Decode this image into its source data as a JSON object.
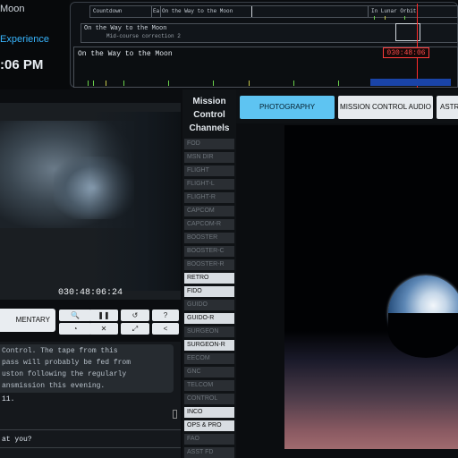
{
  "brand": {
    "title_partial": "Moon",
    "subtitle_partial": "Experience",
    "clock_partial": ":06 PM"
  },
  "timeline": {
    "phases": [
      "Countdown",
      "Ea",
      "On the Way to the Moon",
      "In Lunar Orbit"
    ],
    "current_phase": "On the Way to the Moon",
    "sub_event": "Mid-course correction 2",
    "detail_title": "On the Way to the Moon",
    "mission_elapsed": "030:48:06"
  },
  "video": {
    "timestamp": "030:48:06:24"
  },
  "controls": {
    "commentary_label": "MENTARY",
    "buttons": [
      {
        "icon": "search-icon",
        "glyph": "🔍"
      },
      {
        "icon": "pause-icon",
        "glyph": "❚❚"
      },
      {
        "icon": "history-icon",
        "glyph": "↺"
      },
      {
        "icon": "help-icon",
        "glyph": "?"
      },
      {
        "icon": "speed-icon",
        "glyph": "◔"
      },
      {
        "icon": "mute-icon",
        "glyph": "✕"
      },
      {
        "icon": "fullscreen-icon",
        "glyph": "⤢"
      },
      {
        "icon": "share-icon",
        "glyph": "<"
      }
    ]
  },
  "transcript": {
    "lines": [
      " Control. The tape from this",
      "pass will probably be fed from",
      "uston following the regularly",
      "ansmission this evening."
    ],
    "number_line": " 11.",
    "question_line": "at you?"
  },
  "channels": {
    "title": "Mission Control Channels",
    "items": [
      {
        "label": "FOD",
        "active": false
      },
      {
        "label": "MSN DIR",
        "active": false
      },
      {
        "label": "FLIGHT",
        "active": false
      },
      {
        "label": "FLIGHT-L",
        "active": false
      },
      {
        "label": "FLIGHT-R",
        "active": false
      },
      {
        "label": "CAPCOM",
        "active": false
      },
      {
        "label": "CAPCOM-R",
        "active": false
      },
      {
        "label": "BOOSTER",
        "active": false
      },
      {
        "label": "BOOSTER-C",
        "active": false
      },
      {
        "label": "BOOSTER-R",
        "active": false
      },
      {
        "label": "RETRO",
        "active": true
      },
      {
        "label": "FIDO",
        "active": true
      },
      {
        "label": "GUIDO",
        "active": false
      },
      {
        "label": "GUIDO-R",
        "active": true
      },
      {
        "label": "SURGEON",
        "active": false
      },
      {
        "label": "SURGEON-R",
        "active": true
      },
      {
        "label": "EECOM",
        "active": false
      },
      {
        "label": "GNC",
        "active": false
      },
      {
        "label": "TELCOM",
        "active": false
      },
      {
        "label": "CONTROL",
        "active": false
      },
      {
        "label": "INCO",
        "active": true
      },
      {
        "label": "OPS & PRO",
        "active": true
      },
      {
        "label": "FAO",
        "active": false
      },
      {
        "label": "ASST FD",
        "active": false
      }
    ]
  },
  "tabs": {
    "photography": "PHOTOGRAPHY",
    "audio": "MISSION CONTROL AUDIO",
    "astro_partial": "ASTR"
  },
  "colors": {
    "accent": "#5ec4f2",
    "alert": "#ff3b3b",
    "subtitle": "#38b6ff"
  }
}
